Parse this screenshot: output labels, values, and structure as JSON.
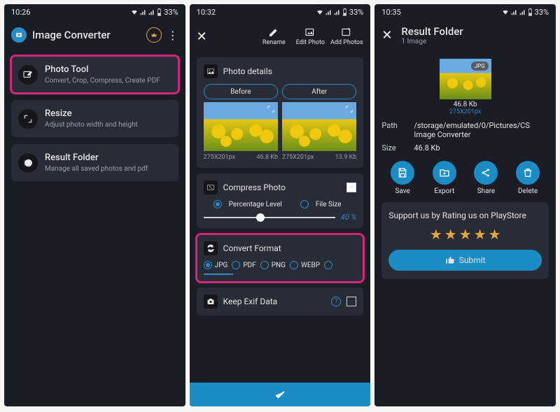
{
  "status": {
    "time1": "10:26",
    "time2": "10:32",
    "time3": "10:35",
    "battery": "33%"
  },
  "screen1": {
    "app_title": "Image Converter",
    "items": [
      {
        "title": "Photo Tool",
        "subtitle": "Convert, Crop, Compress, Create PDF"
      },
      {
        "title": "Resize",
        "subtitle": "Adjust photo width and height"
      },
      {
        "title": "Result Folder",
        "subtitle": "Manage all saved photos and pdf"
      }
    ]
  },
  "screen2": {
    "actions": {
      "rename": "Rename",
      "edit": "Edit Photo",
      "add": "Add Photos"
    },
    "photo_details": {
      "title": "Photo details",
      "before": "Before",
      "after": "After",
      "before_dim": "275X201px",
      "before_size": "46.8 Kb",
      "after_dim": "275X201px",
      "after_size": "13.9 Kb"
    },
    "compress": {
      "title": "Compress Photo",
      "opt1": "Percentage Level",
      "opt2": "File Size",
      "value": "40 %"
    },
    "convert": {
      "title": "Convert Format",
      "opts": [
        "JPG",
        "PDF",
        "PNG",
        "WEBP"
      ]
    },
    "exif": {
      "title": "Keep Exif Data"
    }
  },
  "screen3": {
    "title": "Result Folder",
    "subtitle": "1 Image",
    "thumb": {
      "badge": "JPG",
      "size": "46.8 Kb",
      "dim": "275X201px"
    },
    "path_label": "Path",
    "path_value": "/storage/emulated/0/Pictures/CS Image Converter",
    "size_label": "Size",
    "size_value": "46.8 Kb",
    "actions": {
      "save": "Save",
      "export": "Export",
      "share": "Share",
      "delete": "Delete"
    },
    "rating": {
      "title": "Support us by Rating us on PlayStore",
      "submit": "Submit"
    }
  }
}
